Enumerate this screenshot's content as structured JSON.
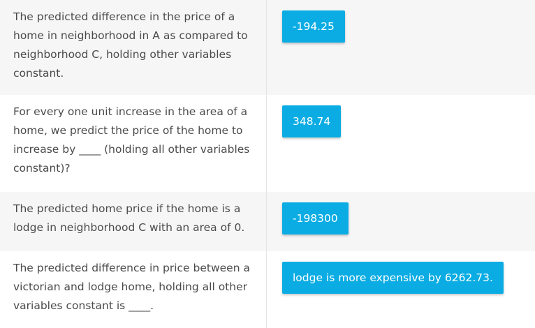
{
  "rows": [
    {
      "prompt": "The predicted difference in the price of a home in neighborhood in A as compared to neighborhood C, holding other variables constant.",
      "answer": "-194.25"
    },
    {
      "prompt": "For every one unit increase in the area of a home, we predict the price of the home to increase by ____ (holding all other variables constant)?",
      "answer": "348.74"
    },
    {
      "prompt": "The predicted home price if the home is a lodge in neighborhood C with an area of 0.",
      "answer": "-198300"
    },
    {
      "prompt": "The predicted difference in price between a victorian and lodge home, holding all other variables constant is ____.",
      "answer": "lodge is more expensive by 6262.73."
    }
  ],
  "colors": {
    "chip_background": "#0aace3",
    "chip_text": "#ffffff",
    "shaded_row": "#f6f6f6",
    "divider": "#e4e4e4",
    "text": "#4a4a4a"
  }
}
